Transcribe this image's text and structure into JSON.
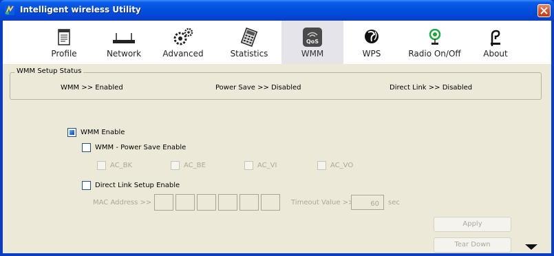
{
  "window": {
    "title": "Intelligent wireless Utility"
  },
  "toolbar": {
    "items": [
      {
        "label": "Profile",
        "icon": "profile-icon"
      },
      {
        "label": "Network",
        "icon": "network-icon"
      },
      {
        "label": "Advanced",
        "icon": "advanced-icon"
      },
      {
        "label": "Statistics",
        "icon": "statistics-icon"
      },
      {
        "label": "WMM",
        "icon": "wmm-icon",
        "active": true
      },
      {
        "label": "WPS",
        "icon": "wps-icon"
      },
      {
        "label": "Radio On/Off",
        "icon": "radio-icon"
      },
      {
        "label": "About",
        "icon": "about-icon"
      }
    ]
  },
  "status": {
    "group_title": "WMM Setup Status",
    "wmm": "WMM >> Enabled",
    "power_save": "Power Save >> Disabled",
    "direct_link": "Direct Link >> Disabled"
  },
  "options": {
    "wmm_enable": {
      "label": "WMM Enable",
      "checked": true
    },
    "power_save_enable": {
      "label": "WMM - Power Save Enable",
      "checked": false
    },
    "ac": [
      {
        "label": "AC_BK"
      },
      {
        "label": "AC_BE"
      },
      {
        "label": "AC_VI"
      },
      {
        "label": "AC_VO"
      }
    ],
    "direct_link_enable": {
      "label": "Direct Link Setup Enable",
      "checked": false
    }
  },
  "direct_link": {
    "mac_label": "MAC Address >>",
    "timeout_label": "Timeout Value >>",
    "timeout_value": "60",
    "timeout_unit": "sec"
  },
  "buttons": {
    "apply": "Apply",
    "tear_down": "Tear Down"
  },
  "colors": {
    "titlebar": "#0450de",
    "panel": "#ece9d8",
    "disabled_text": "#aca899"
  }
}
